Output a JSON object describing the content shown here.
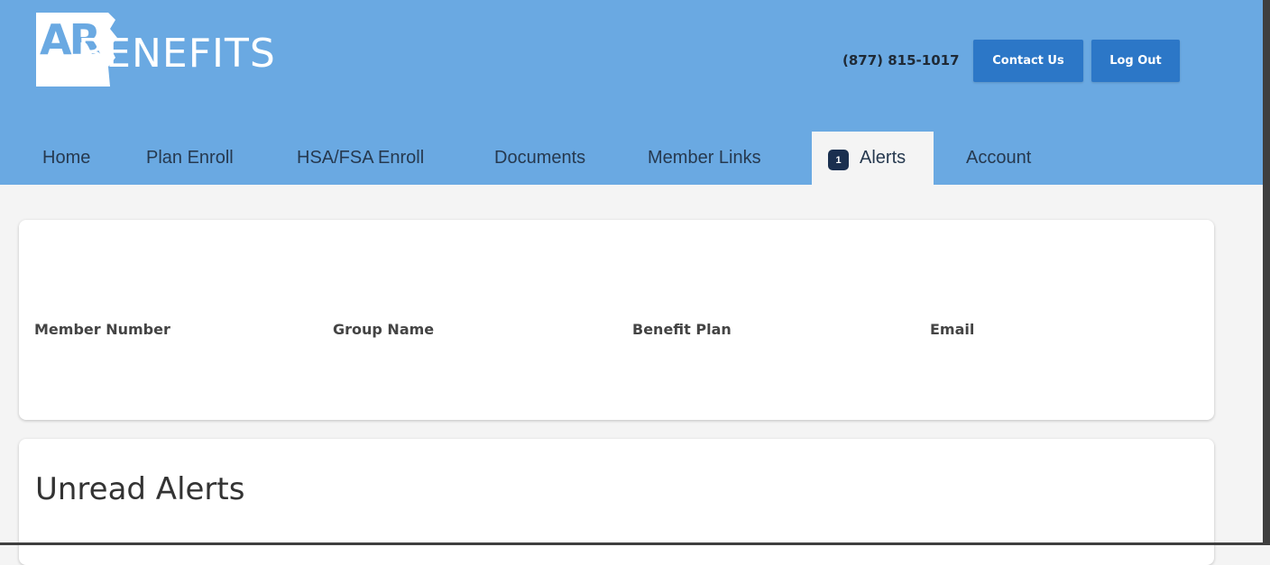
{
  "header": {
    "logo_alt": "AR BENEFITS",
    "logo_text": "BENEFITS",
    "logo_monogram": "AR",
    "phone": "(877) 815-1017",
    "contact_label": "Contact Us",
    "logout_label": "Log Out"
  },
  "nav": {
    "items": [
      {
        "label": "Home"
      },
      {
        "label": "Plan Enroll"
      },
      {
        "label": "HSA/FSA Enroll"
      },
      {
        "label": "Documents"
      },
      {
        "label": "Member Links"
      },
      {
        "label": "Alerts",
        "badge": "1",
        "active": true
      },
      {
        "label": "Account"
      }
    ]
  },
  "member_info": {
    "member_number_label": "Member Number",
    "group_name_label": "Group Name",
    "benefit_plan_label": "Benefit Plan",
    "email_label": "Email"
  },
  "alerts": {
    "title": "Unread Alerts"
  },
  "colors": {
    "header_bg": "#6aa9e2",
    "button_bg": "#2c77c7",
    "badge_bg": "#1a2f4f",
    "page_bg": "#f4f4f4"
  }
}
